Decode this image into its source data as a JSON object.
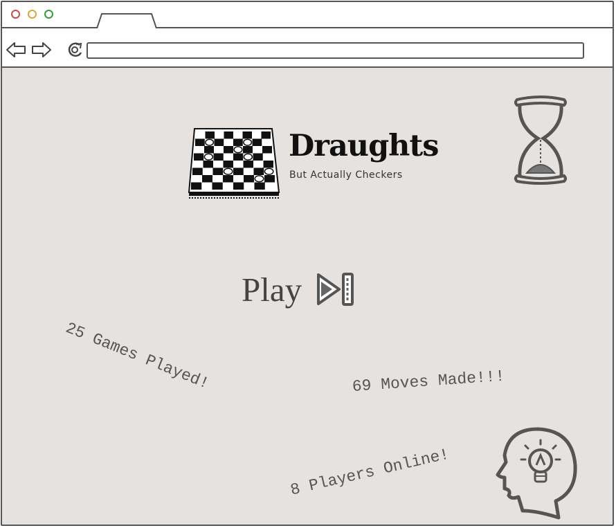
{
  "browser": {
    "dots": [
      {
        "name": "close",
        "color": "#c0504d"
      },
      {
        "name": "minimize",
        "color": "#e0a43c"
      },
      {
        "name": "maximize",
        "color": "#3a9a3a"
      }
    ]
  },
  "logo": {
    "title": "Draughts",
    "subtitle": "But Actually Checkers"
  },
  "play": {
    "label": "Play"
  },
  "stats": {
    "games": "25 Games Played!",
    "moves": "69 Moves Made!!!",
    "players": "8 Players Online!"
  },
  "icons": {
    "board": "checkerboard-icon",
    "hourglass": "hourglass-icon",
    "play": "play-skip-icon",
    "idea": "lightbulb-head-icon"
  }
}
